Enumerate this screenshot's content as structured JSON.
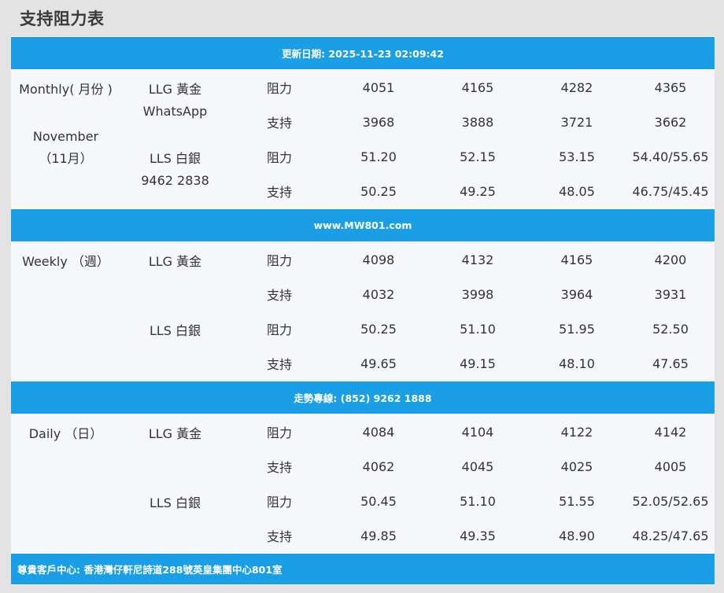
{
  "title": "支持阻力表",
  "header_banner": "更新日期: 2025-11-23 02:09:42",
  "mid_banner_1": "www.MW801.com",
  "mid_banner_2": "走勢專線: (852) 9262 1888",
  "footer_banner": "尊貴客戶中心: 香港灣仔軒尼詩道288號英皇集團中心801室",
  "monthly": {
    "period_line1": "Monthly( 月份 )",
    "period_line2": "November",
    "period_line3": "（11月）",
    "metal1_line1": "LLG 黃金",
    "metal1_line2": "WhatsApp",
    "metal2_line1": "LLS 白銀",
    "metal2_line2": "9462 2838",
    "rows": [
      {
        "type": "阻力",
        "v": [
          "4051",
          "4165",
          "4282",
          "4365"
        ]
      },
      {
        "type": "支持",
        "v": [
          "3968",
          "3888",
          "3721",
          "3662"
        ]
      },
      {
        "type": "阻力",
        "v": [
          "51.20",
          "52.15",
          "53.15",
          "54.40/55.65"
        ]
      },
      {
        "type": "支持",
        "v": [
          "50.25",
          "49.25",
          "48.05",
          "46.75/45.45"
        ]
      }
    ]
  },
  "weekly": {
    "period": "Weekly （週）",
    "metal1": "LLG 黃金",
    "metal2": "LLS 白銀",
    "rows": [
      {
        "type": "阻力",
        "v": [
          "4098",
          "4132",
          "4165",
          "4200"
        ]
      },
      {
        "type": "支持",
        "v": [
          "4032",
          "3998",
          "3964",
          "3931"
        ]
      },
      {
        "type": "阻力",
        "v": [
          "50.25",
          "51.10",
          "51.95",
          "52.50"
        ]
      },
      {
        "type": "支持",
        "v": [
          "49.65",
          "49.15",
          "48.10",
          "47.65"
        ]
      }
    ]
  },
  "daily": {
    "period": "Daily （日）",
    "metal1": "LLG 黃金",
    "metal2": "LLS 白銀",
    "rows": [
      {
        "type": "阻力",
        "v": [
          "4084",
          "4104",
          "4122",
          "4142"
        ]
      },
      {
        "type": "支持",
        "v": [
          "4062",
          "4045",
          "4025",
          "4005"
        ]
      },
      {
        "type": "阻力",
        "v": [
          "50.45",
          "51.10",
          "51.55",
          "52.05/52.65"
        ]
      },
      {
        "type": "支持",
        "v": [
          "49.85",
          "49.35",
          "48.90",
          "48.25/47.65"
        ]
      }
    ]
  },
  "colors": {
    "banner": "#1a9ee6",
    "section_bg": "#f5f7fa",
    "page_bg": "#e3e3e3"
  }
}
